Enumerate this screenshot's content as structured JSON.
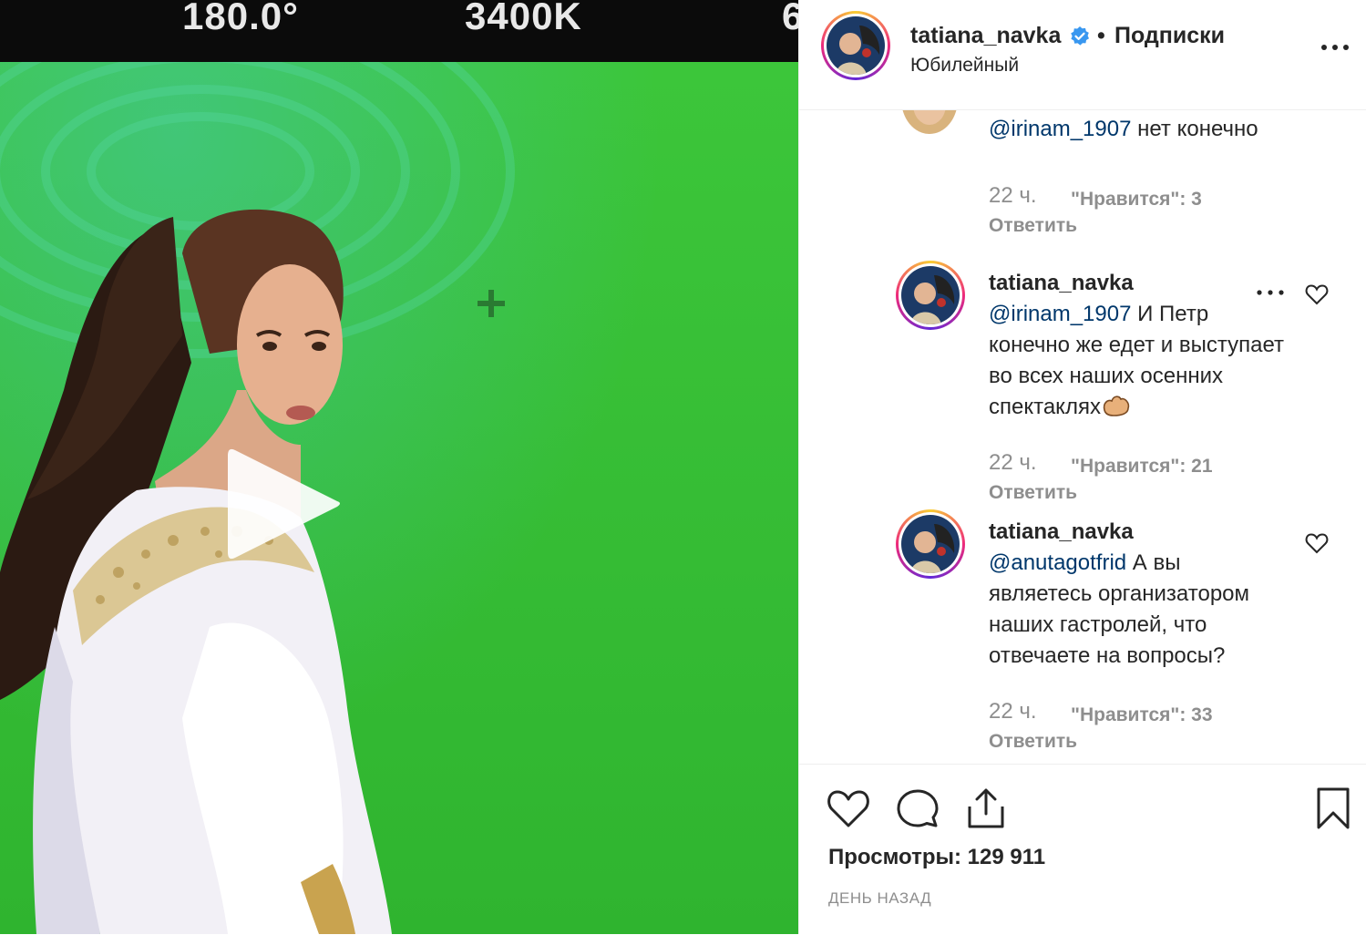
{
  "video": {
    "hud_left": "180.0°",
    "hud_center": "3400K",
    "hud_right": "6"
  },
  "post": {
    "username": "tatiana_navka",
    "separator": "•",
    "follow_label": "Подписки",
    "location": "Юбилейный"
  },
  "comments": [
    {
      "mention": "@irinam_1907",
      "text": " нет конечно",
      "time": "22 ч.",
      "likes": "\"Нравится\": 3",
      "reply": "Ответить"
    },
    {
      "username": "tatiana_navka",
      "mention": "@irinam_1907",
      "text": " И Петр конечно же едет и выступает во всех наших осенних спектаклях",
      "time": "22 ч.",
      "likes": "\"Нравится\": 21",
      "reply": "Ответить"
    },
    {
      "username": "tatiana_navka",
      "mention": "@anutagotfrid",
      "text": " А вы являетесь организатором наших гастролей, что отвечаете на вопросы?",
      "time": "22 ч.",
      "likes": "\"Нравится\": 33",
      "reply": "Ответить"
    }
  ],
  "stats": {
    "views": "Просмотры: 129 911",
    "date": "ДЕНЬ НАЗАД"
  },
  "icons": {
    "play": "play-icon",
    "verified": "verified-badge-icon",
    "more": "more-options-icon",
    "like": "heart-icon",
    "comment": "comment-icon",
    "share": "share-icon",
    "save": "bookmark-icon",
    "flex": "flexed-biceps-emoji"
  },
  "colors": {
    "green_screen": "#3fc23a",
    "mention": "#00376b",
    "secondary_text": "#8e8e8e",
    "verified_blue": "#3897f0"
  }
}
